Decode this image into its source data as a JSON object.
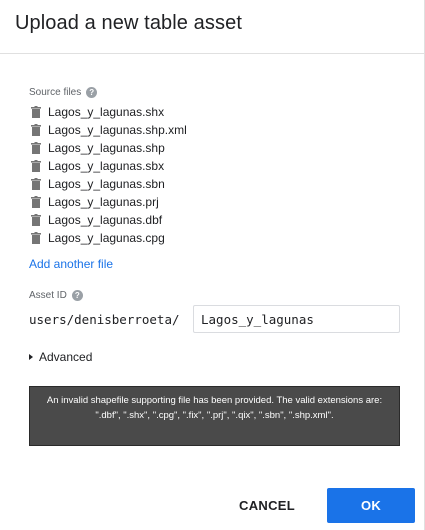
{
  "dialog": {
    "title": "Upload a new table asset"
  },
  "source_files": {
    "label": "Source files",
    "help_icon": "help-circle-icon",
    "item_icon": "trash-icon",
    "files": [
      "Lagos_y_lagunas.shx",
      "Lagos_y_lagunas.shp.xml",
      "Lagos_y_lagunas.shp",
      "Lagos_y_lagunas.sbx",
      "Lagos_y_lagunas.sbn",
      "Lagos_y_lagunas.prj",
      "Lagos_y_lagunas.dbf",
      "Lagos_y_lagunas.cpg"
    ],
    "add_link": "Add another file"
  },
  "asset_id": {
    "label": "Asset ID",
    "help_icon": "help-circle-icon",
    "path_prefix": "users/denisberroeta/",
    "value": "Lagos_y_lagunas"
  },
  "advanced": {
    "label": "Advanced",
    "icon": "caret-right-icon"
  },
  "error": {
    "message": "An invalid shapefile supporting file has been provided. The valid extensions are: \".dbf\", \".shx\", \".cpg\", \".fix\", \".prj\", \".qix\", \".sbn\", \".shp.xml\"."
  },
  "actions": {
    "cancel_label": "CANCEL",
    "ok_label": "OK"
  },
  "colors": {
    "accent": "#1a73e8",
    "error_bg": "#4a4a4a",
    "icon_gray": "#757575"
  }
}
